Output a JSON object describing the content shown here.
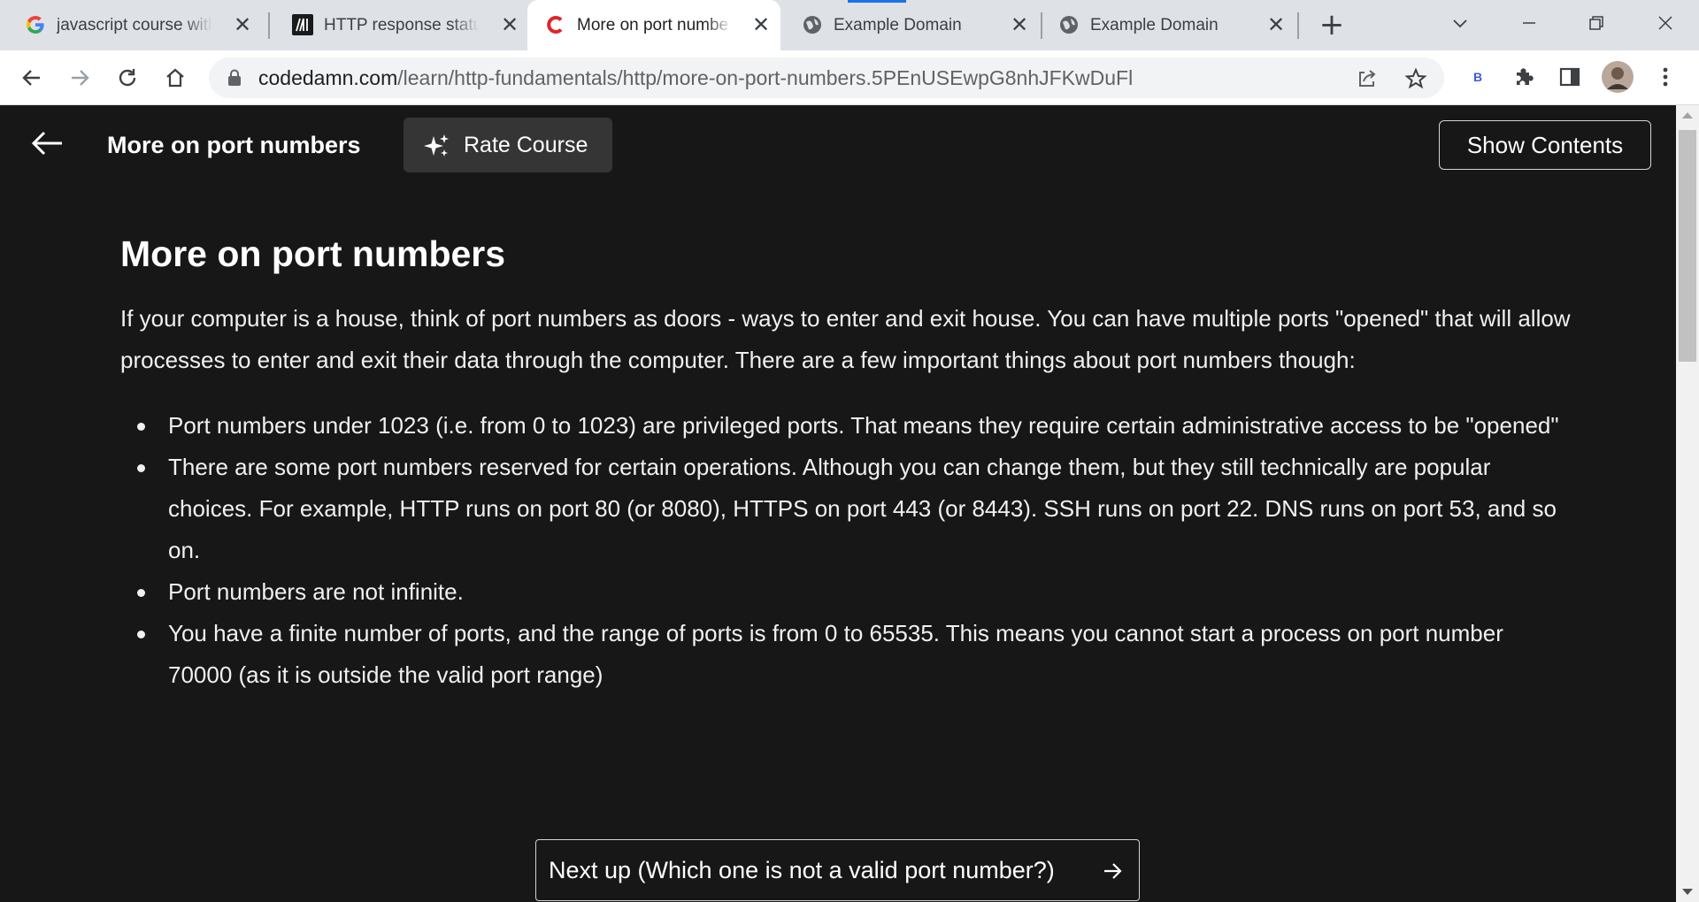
{
  "browser": {
    "tabs": [
      {
        "title": "javascript course with",
        "favicon": "google-g-icon"
      },
      {
        "title": "HTTP response status",
        "favicon": "mdn-m-icon"
      },
      {
        "title": "More on port numbe",
        "favicon": "codedamn-c-icon",
        "active": true
      },
      {
        "title": "Example Domain",
        "favicon": "globe-icon"
      },
      {
        "title": "Example Domain",
        "favicon": "globe-icon"
      }
    ],
    "new_tab_label": "+",
    "close_glyph": "✕",
    "url_domain": "codedamn.com",
    "url_path": "/learn/http-fundamentals/http/more-on-port-numbers.5PEnUSEwpG8nhJFKwDuFl",
    "extension_badge": "B",
    "accent_color": "#1a73e8"
  },
  "header": {
    "title": "More on port numbers",
    "rate_course": "Rate Course",
    "show_contents": "Show Contents"
  },
  "article": {
    "heading": "More on port numbers",
    "intro": "If your computer is a house, think of port numbers as doors - ways to enter and exit house. You can have multiple ports \"opened\" that will allow processes to enter and exit their data through the computer. There are a few important things about port numbers though:",
    "bullets": [
      "Port numbers under 1023 (i.e. from 0 to 1023) are privileged ports. That means they require certain administrative access to be \"opened\"",
      "There are some port numbers reserved for certain operations. Although you can change them, but they still technically are popular choices. For example, HTTP runs on port 80 (or 8080), HTTPS on port 443 (or 8443). SSH runs on port 22. DNS runs on port 53, and so on.",
      "Port numbers are not infinite.",
      "You have a finite number of ports, and the range of ports is from 0 to 65535. This means you cannot start a process on port number 70000 (as it is outside the valid port range)"
    ]
  },
  "footer": {
    "next_up": "Next up (Which one is not a valid port number?)"
  }
}
